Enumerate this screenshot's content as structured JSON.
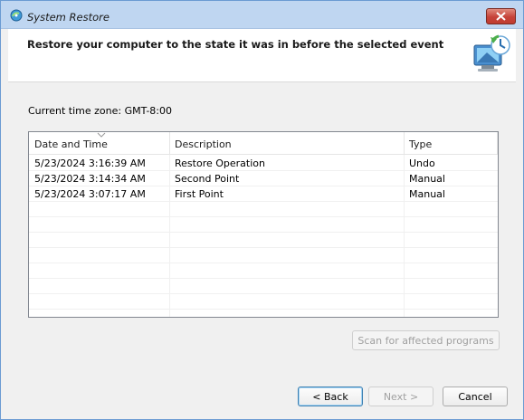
{
  "window": {
    "title": "System Restore"
  },
  "header": {
    "heading": "Restore your computer to the state it was in before the selected event"
  },
  "timezone": {
    "label": "Current time zone: GMT-8:00"
  },
  "list": {
    "columns": [
      "Date and Time",
      "Description",
      "Type"
    ],
    "rows": [
      {
        "date_time": "5/23/2024 3:16:39 AM",
        "description": "Restore Operation",
        "type": "Undo"
      },
      {
        "date_time": "5/23/2024 3:14:34 AM",
        "description": "Second Point",
        "type": "Manual"
      },
      {
        "date_time": "5/23/2024 3:07:17 AM",
        "description": "First Point",
        "type": "Manual"
      }
    ]
  },
  "buttons": {
    "scan": "Scan for affected programs",
    "back": "< Back",
    "next": "Next >",
    "cancel": "Cancel"
  },
  "icons": {
    "title": "system-restore-icon",
    "header": "system-restore-large-icon",
    "close": "close-icon",
    "sort": "sort-ascending-icon"
  },
  "colors": {
    "titlebar": "#bfd6f1",
    "close_button": "#c6443a",
    "default_button_border": "#3c7fb1"
  }
}
